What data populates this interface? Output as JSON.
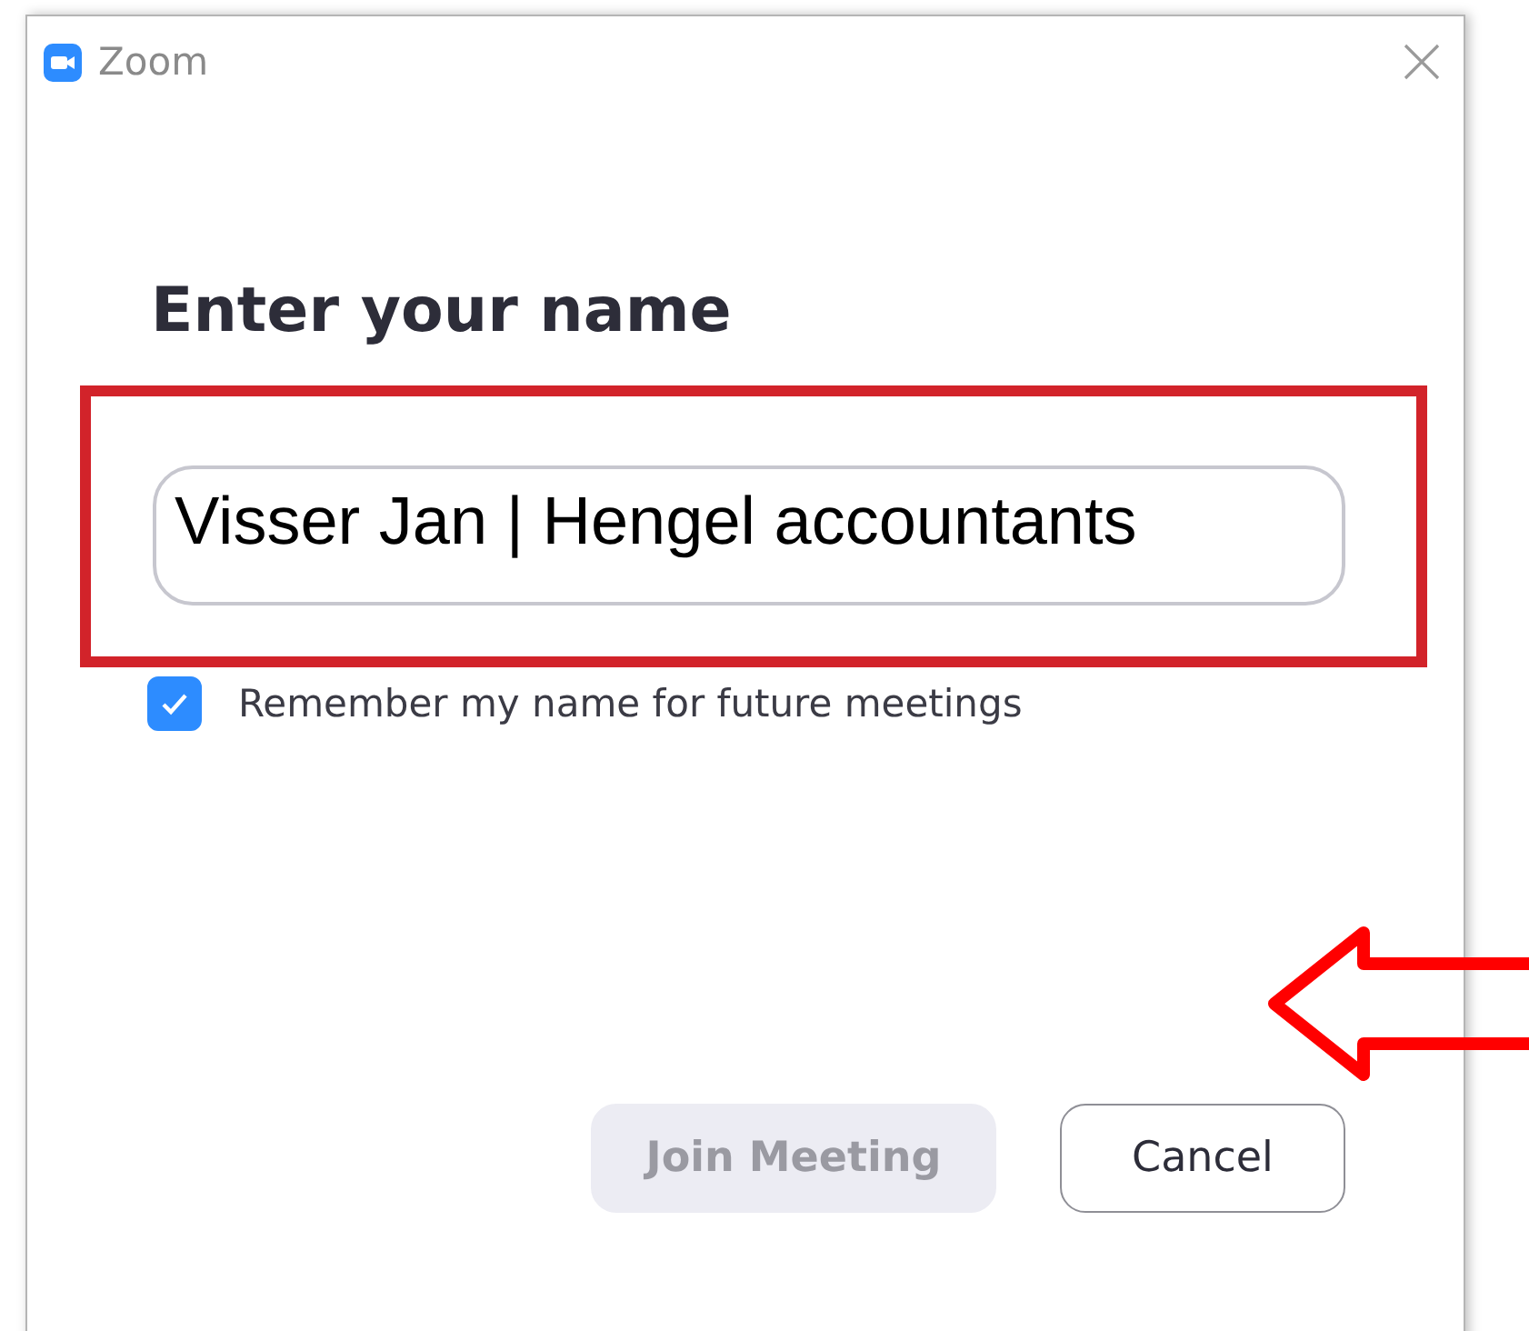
{
  "window": {
    "title": "Zoom"
  },
  "heading": "Enter your name",
  "remember_checkbox": {
    "label": "Remember my name for future meetings",
    "checked": true
  },
  "buttons": [
    {
      "label": "Join Meeting",
      "disabled": true
    },
    {
      "label": "Cancel",
      "disabled": false
    }
  ],
  "annotation": {
    "text": "Visser Jan | Hengel accountants"
  }
}
